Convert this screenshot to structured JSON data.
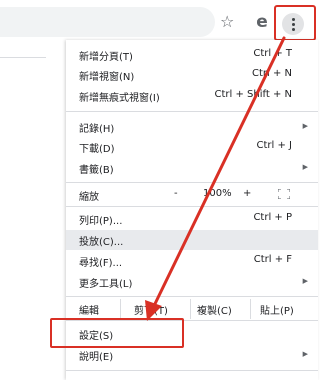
{
  "toolbar": {
    "star_icon": "☆",
    "avatar_icon": "e",
    "menu_icon": "⋮"
  },
  "menu": {
    "new_tab": {
      "label": "新增分頁(T)",
      "shortcut": "Ctrl + T"
    },
    "new_window": {
      "label": "新增視窗(N)",
      "shortcut": "Ctrl + N"
    },
    "incognito": {
      "label": "新增無痕式視窗(I)",
      "shortcut": "Ctrl + Shift + N"
    },
    "history": {
      "label": "記錄(H)"
    },
    "downloads": {
      "label": "下載(D)",
      "shortcut": "Ctrl + J"
    },
    "bookmarks": {
      "label": "書籤(B)"
    },
    "zoom": {
      "label": "縮放",
      "minus": "-",
      "value": "100%",
      "plus": "+"
    },
    "print": {
      "label": "列印(P)...",
      "shortcut": "Ctrl + P"
    },
    "cast": {
      "label": "投放(C)..."
    },
    "find": {
      "label": "尋找(F)...",
      "shortcut": "Ctrl + F"
    },
    "more_tools": {
      "label": "更多工具(L)"
    },
    "edit": {
      "label": "編輯",
      "cut": "剪下(T)",
      "copy": "複製(C)",
      "paste": "貼上(P)"
    },
    "settings": {
      "label": "設定(S)"
    },
    "help": {
      "label": "說明(E)"
    }
  },
  "colors": {
    "highlight": "#d93025",
    "hover": "#e8eaed"
  }
}
